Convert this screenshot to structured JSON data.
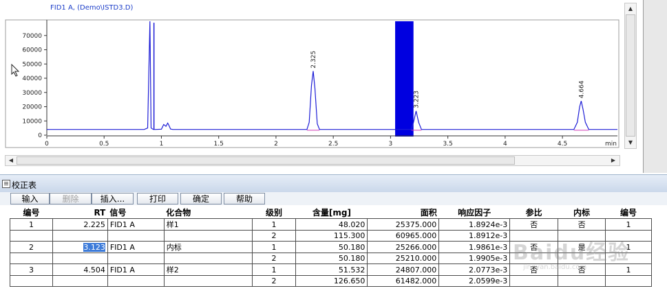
{
  "chromatogram": {
    "title": "FID1 A, (Demo\\ISTD3.D)",
    "x_unit": "min",
    "x_ticks": [
      "0",
      "0.5",
      "1",
      "1.5",
      "2",
      "2.5",
      "3",
      "3.5",
      "4",
      "4.5"
    ],
    "y_ticks": [
      "0",
      "10000",
      "20000",
      "30000",
      "40000",
      "50000",
      "60000",
      "70000"
    ],
    "peak_labels": [
      "2.325",
      "3.223",
      "4.664"
    ]
  },
  "chart_data": {
    "type": "line",
    "title": "FID1 A, (Demo\\ISTD3.D)",
    "xlabel": "min",
    "ylabel": "",
    "xlim": [
      0,
      4.98
    ],
    "ylim": [
      0,
      80000
    ],
    "series": [
      {
        "x": [
          0.0,
          0.85,
          0.88,
          0.9,
          0.91,
          0.93,
          0.95,
          1.0,
          1.02,
          1.04,
          1.055,
          1.065,
          1.08,
          1.1,
          2.27,
          2.29,
          2.31,
          2.325,
          2.34,
          2.36,
          2.38,
          3.18,
          3.2,
          3.223,
          3.245,
          3.27,
          4.6,
          4.63,
          4.65,
          4.664,
          4.68,
          4.7,
          4.73,
          4.98
        ],
        "y": [
          4000,
          4000,
          5000,
          80000,
          5000,
          4000,
          4000,
          4200,
          7500,
          6200,
          8500,
          7000,
          4300,
          4000,
          4000,
          9000,
          35000,
          45000,
          33000,
          8000,
          4000,
          4000,
          9000,
          17000,
          9000,
          4000,
          4000,
          9000,
          20000,
          24000,
          18000,
          9000,
          4000,
          4000
        ]
      }
    ],
    "markers": [
      {
        "time": 2.325,
        "label": "2.325"
      },
      {
        "time": 3.223,
        "label": "3.223"
      },
      {
        "time": 4.664,
        "label": "4.664"
      }
    ],
    "highlight_window": [
      3.04,
      3.2
    ],
    "colors": {
      "trace": "#1c1cd6",
      "baseline": "#d23ab6",
      "highlight": "#0000e0"
    }
  },
  "panel": {
    "title": "校正表",
    "buttons": [
      "输入",
      "删除",
      "插入...",
      "打印",
      "确定",
      "帮助"
    ]
  },
  "table": {
    "headers": [
      "编号",
      "RT",
      "信号",
      "化合物",
      "级别",
      "含量[mg]",
      "面积",
      "响应因子",
      "参比",
      "内标",
      "编号"
    ],
    "rows": [
      [
        "1",
        "2.225",
        "FID1 A",
        "样1",
        "1",
        "48.020",
        "25375.000",
        "1.8924e-3",
        "否",
        "否",
        "1"
      ],
      [
        "",
        "",
        "",
        "",
        "2",
        "115.300",
        "60965.000",
        "1.8912e-3",
        "",
        "",
        ""
      ],
      [
        "2",
        "3.123",
        "FID1 A",
        "内标",
        "1",
        "50.180",
        "25266.000",
        "1.9861e-3",
        "否",
        "是",
        "1"
      ],
      [
        "",
        "",
        "",
        "",
        "2",
        "50.180",
        "25210.000",
        "1.9905e-3",
        "",
        "",
        ""
      ],
      [
        "3",
        "4.504",
        "FID1 A",
        "样2",
        "1",
        "51.532",
        "24807.000",
        "2.0773e-3",
        "否",
        "否",
        "1"
      ],
      [
        "",
        "",
        "",
        "",
        "2",
        "126.650",
        "61482.000",
        "2.0599e-3",
        "",
        "",
        ""
      ]
    ]
  },
  "watermark": {
    "text": "Baidu经验",
    "sub": "jingyan.baidu.com"
  }
}
